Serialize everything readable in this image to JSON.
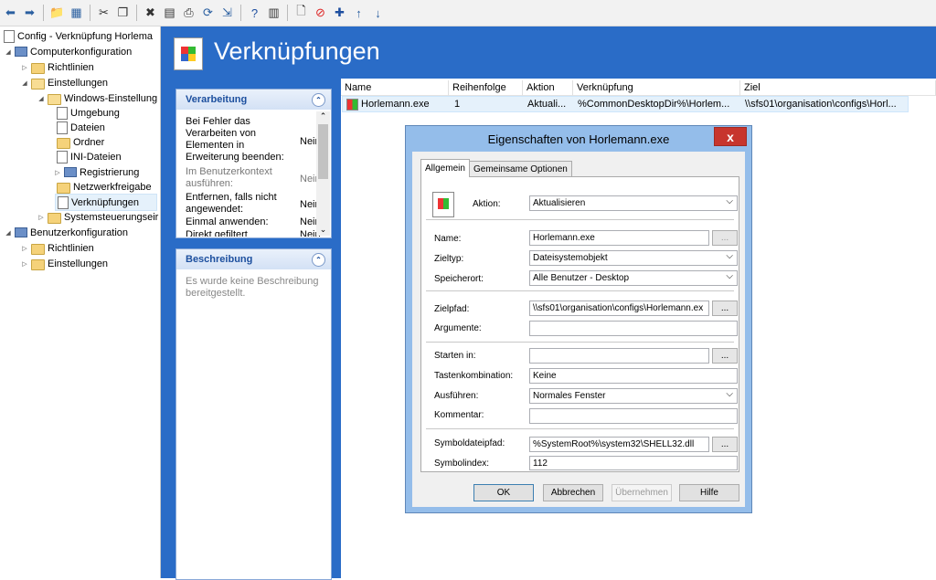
{
  "tree": {
    "root": "Config - Verknüpfung Horlema",
    "computer": "Computerkonfiguration",
    "richtlinien": "Richtlinien",
    "einstellungen": "Einstellungen",
    "windows": "Windows-Einstellung",
    "umgebung": "Umgebung",
    "dateien": "Dateien",
    "ordner": "Ordner",
    "ini": "INI-Dateien",
    "registrierung": "Registrierung",
    "netzwerk": "Netzwerkfreigabe",
    "verknuepfungen": "Verknüpfungen",
    "systemsteuerung": "Systemsteuerungseir",
    "benutzer": "Benutzerkonfiguration",
    "b_richtlinien": "Richtlinien",
    "b_einstellungen": "Einstellungen"
  },
  "banner": {
    "title": "Verknüpfungen"
  },
  "verarbeitung": {
    "title": "Verarbeitung",
    "r1": "Bei Fehler das Verarbeiten von Elementen in Erweiterung beenden:",
    "r1v": "Nein",
    "r2": "Im Benutzerkontext ausführen:",
    "r2v": "Nein",
    "r3": "Entfernen, falls nicht angewendet:",
    "r3v": "Nein",
    "r4": "Einmal anwenden:",
    "r4v": "Nein",
    "r5": "Direkt gefiltert",
    "r5v": "Nein"
  },
  "beschreibung": {
    "title": "Beschreibung",
    "text": "Es wurde keine Beschreibung bereitgestellt."
  },
  "list": {
    "h_name": "Name",
    "h_reihe": "Reihenfolge",
    "h_aktion": "Aktion",
    "h_verkn": "Verknüpfung",
    "h_ziel": "Ziel",
    "row": {
      "name": "Horlemann.exe",
      "reihe": "1",
      "aktion": "Aktuali...",
      "verkn": "%CommonDesktopDir%\\Horlem...",
      "ziel": "\\\\sfs01\\organisation\\configs\\Horl..."
    }
  },
  "dialog": {
    "title": "Eigenschaften von Horlemann.exe",
    "close": "x",
    "tab_allgemein": "Allgemein",
    "tab_gemeinsam": "Gemeinsame Optionen",
    "aktion_label": "Aktion:",
    "aktion_value": "Aktualisieren",
    "name_label": "Name:",
    "name_value": "Horlemann.exe",
    "zieltyp_label": "Zieltyp:",
    "zieltyp_value": "Dateisystemobjekt",
    "speicherort_label": "Speicherort:",
    "speicherort_value": "Alle Benutzer - Desktop",
    "zielpfad_label": "Zielpfad:",
    "zielpfad_value": "\\\\sfs01\\organisation\\configs\\Horlemann.ex",
    "argumente_label": "Argumente:",
    "argumente_value": "",
    "starten_label": "Starten in:",
    "starten_value": "",
    "tasten_label": "Tastenkombination:",
    "tasten_value": "Keine",
    "ausfuehren_label": "Ausführen:",
    "ausfuehren_value": "Normales Fenster",
    "kommentar_label": "Kommentar:",
    "kommentar_value": "",
    "symbolpfad_label": "Symboldateipfad:",
    "symbolpfad_value": "%SystemRoot%\\system32\\SHELL32.dll",
    "symbolindex_label": "Symbolindex:",
    "symbolindex_value": "112",
    "browse": "...",
    "ok": "OK",
    "abbrechen": "Abbrechen",
    "uebernehmen": "Übernehmen",
    "hilfe": "Hilfe"
  }
}
